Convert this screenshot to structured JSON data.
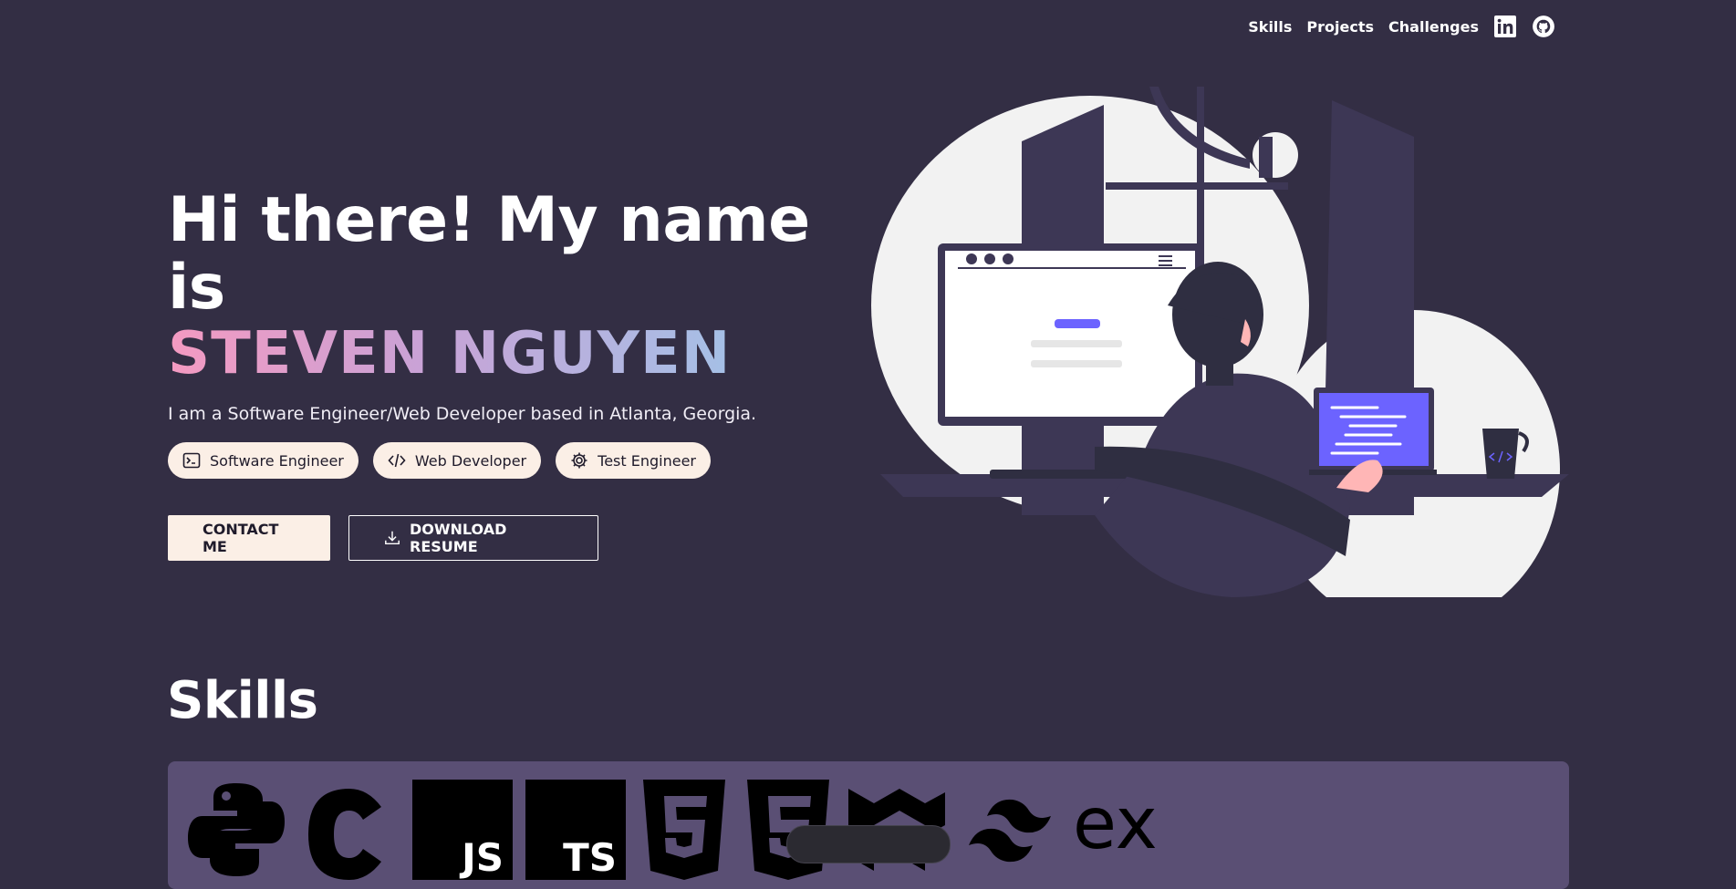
{
  "nav": {
    "links": [
      "Skills",
      "Projects",
      "Challenges"
    ],
    "icons": [
      "linkedin-icon",
      "github-icon"
    ]
  },
  "hero": {
    "greeting": "Hi there! My name is",
    "name": "STEVEN NGUYEN",
    "tagline": "I am a Software Engineer/Web Developer based in Atlanta, Georgia.",
    "roles": [
      {
        "label": "Software Engineer",
        "icon": "terminal-icon"
      },
      {
        "label": "Web Developer",
        "icon": "code-icon"
      },
      {
        "label": "Test Engineer",
        "icon": "gear-icon"
      }
    ],
    "contact_label": "CONTACT ME",
    "resume_label": "DOWNLOAD RESUME"
  },
  "skills": {
    "title": "Skills",
    "logos": [
      "python-icon",
      "c-icon",
      "javascript-icon",
      "typescript-icon",
      "html5-icon",
      "css3-icon",
      "mui-icon",
      "tailwind-icon",
      "express-icon"
    ],
    "logo_text": {
      "javascript": "JS",
      "typescript": "TS",
      "express": "ex"
    }
  },
  "colors": {
    "background": "#332e44",
    "chip": "#fbefe6",
    "accent": "#6c63ff",
    "panel": "#5a4f74"
  }
}
